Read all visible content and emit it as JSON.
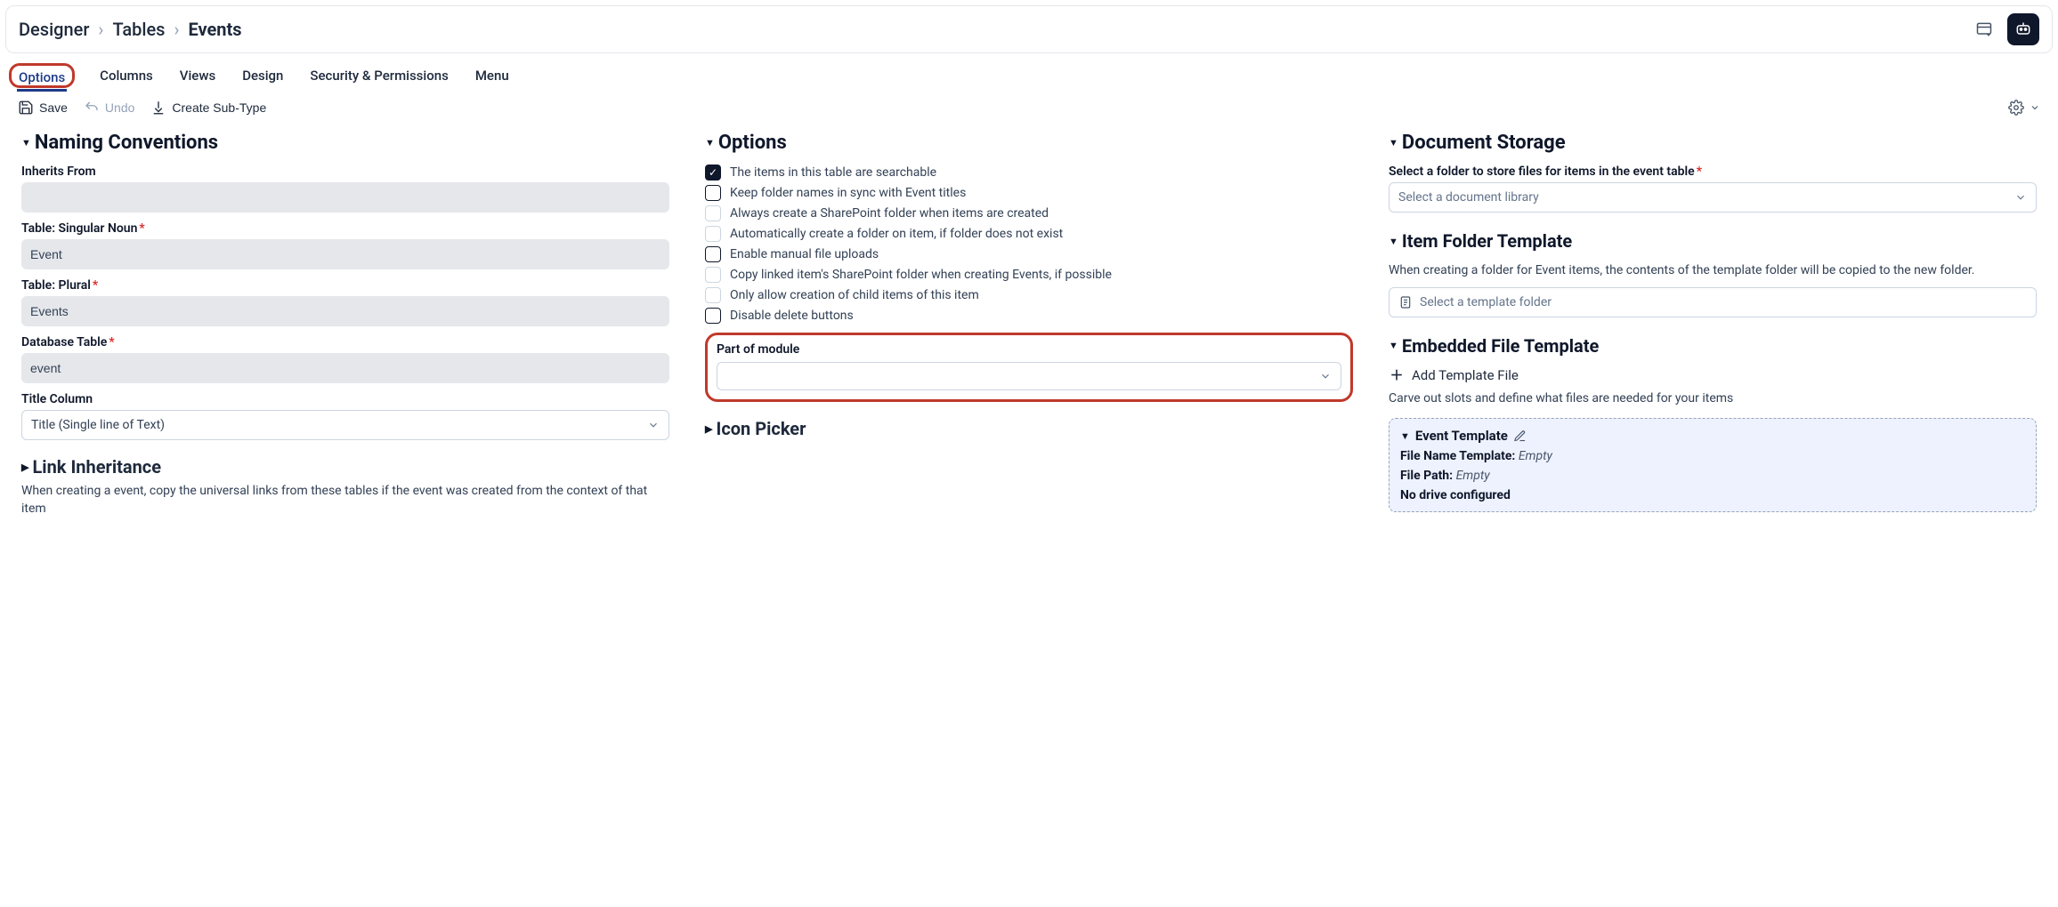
{
  "breadcrumb": {
    "items": [
      "Designer",
      "Tables",
      "Events"
    ]
  },
  "tabs": {
    "items": [
      "Options",
      "Columns",
      "Views",
      "Design",
      "Security & Permissions",
      "Menu"
    ],
    "active": 0
  },
  "actions": {
    "save": "Save",
    "undo": "Undo",
    "sub": "Create Sub-Type"
  },
  "naming": {
    "title": "Naming Conventions",
    "inherits_label": "Inherits From",
    "inherits_value": "",
    "singular_label": "Table: Singular Noun",
    "singular_value": "Event",
    "plural_label": "Table: Plural",
    "plural_value": "Events",
    "dbtable_label": "Database Table",
    "dbtable_value": "event",
    "titlecol_label": "Title Column",
    "titlecol_value": "Title (Single line of Text)"
  },
  "link_inherit": {
    "title": "Link Inheritance",
    "desc": "When creating a event, copy the universal links from these tables if the event was created from the context of that item"
  },
  "options": {
    "title": "Options",
    "checks": [
      {
        "label": "The items in this table are searchable",
        "checked": true,
        "strong": true
      },
      {
        "label": "Keep folder names in sync with Event titles",
        "checked": false,
        "strong": true
      },
      {
        "label": "Always create a SharePoint folder when items are created",
        "checked": false,
        "strong": false
      },
      {
        "label": "Automatically create a folder on item, if folder does not exist",
        "checked": false,
        "strong": false
      },
      {
        "label": "Enable manual file uploads",
        "checked": false,
        "strong": true
      },
      {
        "label": "Copy linked item's SharePoint folder when creating Events, if possible",
        "checked": false,
        "strong": false
      },
      {
        "label": "Only allow creation of child items of this item",
        "checked": false,
        "strong": false
      },
      {
        "label": "Disable delete buttons",
        "checked": false,
        "strong": true
      }
    ],
    "module_label": "Part of module",
    "module_value": ""
  },
  "icon_picker": {
    "title": "Icon Picker"
  },
  "doc_storage": {
    "title": "Document Storage",
    "select_label": "Select a folder to store files for items in the event table",
    "select_placeholder": "Select a document library"
  },
  "item_folder": {
    "title": "Item Folder Template",
    "desc": "When creating a folder for Event items, the contents of the template folder will be copied to the new folder.",
    "select_placeholder": "Select a template folder"
  },
  "embedded": {
    "title": "Embedded File Template",
    "add_label": "Add Template File",
    "desc": "Carve out slots and define what files are needed for your items",
    "tpl_title": "Event Template",
    "fname_label": "File Name Template:",
    "fname_value": "Empty",
    "fpath_label": "File Path:",
    "fpath_value": "Empty",
    "no_drive": "No drive configured"
  }
}
